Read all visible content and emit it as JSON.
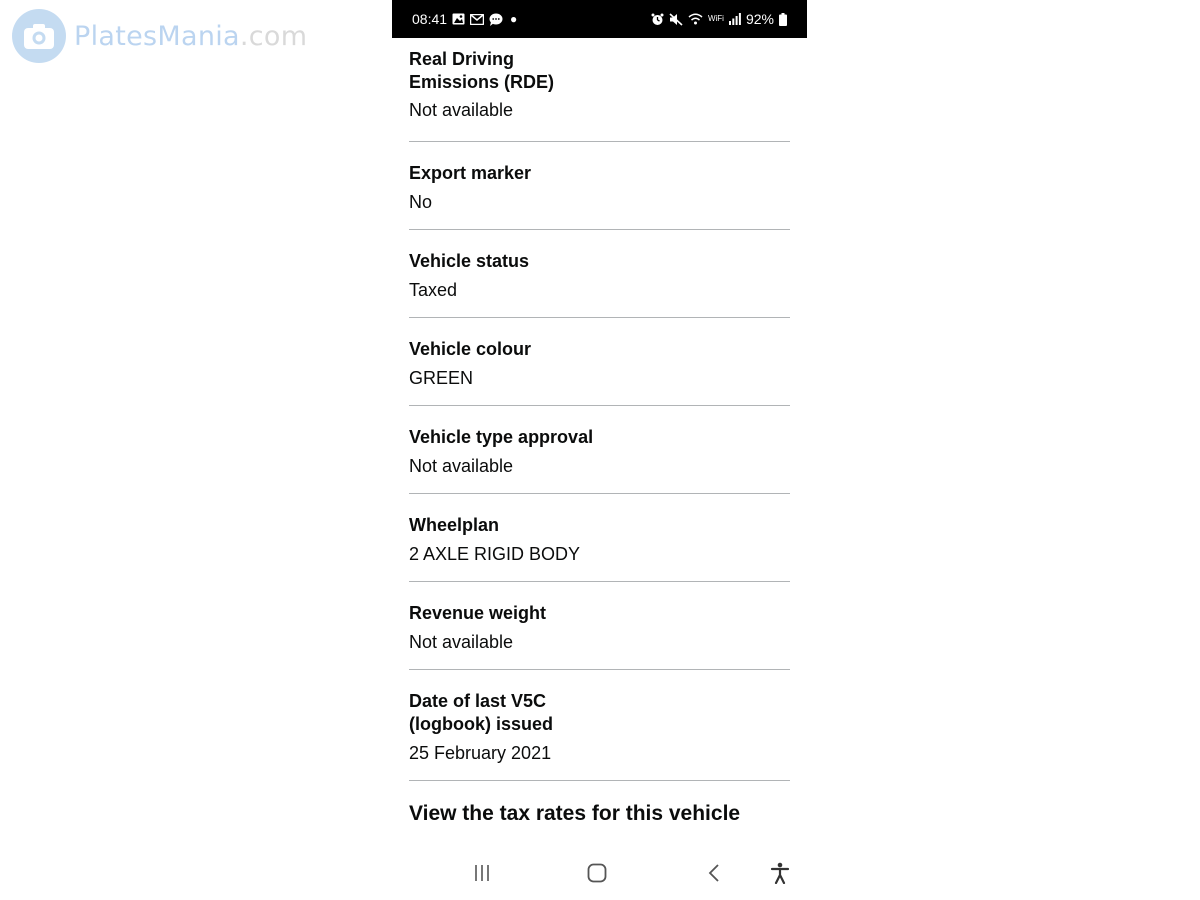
{
  "watermark": {
    "brand_part1": "Plates",
    "brand_part2": "Mania",
    "brand_part3": ".com",
    "icon": "camera-icon"
  },
  "status_bar": {
    "time": "08:41",
    "battery_percent": "92%",
    "wifi_label": "WiFi",
    "left_icons": [
      "gallery-icon",
      "gmail-icon",
      "messages-icon",
      "notification-dot-icon"
    ],
    "right_icons": [
      "alarm-icon",
      "mute-icon",
      "wifi-calling-icon",
      "signal-icon",
      "battery-icon"
    ]
  },
  "details": [
    {
      "label": "Real Driving Emissions (RDE)",
      "value": "Not available"
    },
    {
      "label": "Export marker",
      "value": "No"
    },
    {
      "label": "Vehicle status",
      "value": "Taxed"
    },
    {
      "label": "Vehicle colour",
      "value": "GREEN"
    },
    {
      "label": "Vehicle type approval",
      "value": "Not available"
    },
    {
      "label": "Wheelplan",
      "value": "2 AXLE RIGID BODY"
    },
    {
      "label": "Revenue weight",
      "value": "Not available"
    },
    {
      "label": "Date of last V5C (logbook) issued",
      "value": "25 February 2021"
    }
  ],
  "tax_link": "View the tax rates for this vehicle",
  "nav_bar": {
    "icons": [
      "recent-apps-icon",
      "home-icon",
      "back-icon",
      "accessibility-icon"
    ]
  },
  "colors": {
    "text": "#0b0c0c",
    "divider": "#b1b4b6",
    "status_bar_bg": "#000000",
    "nav_icons": "#555555"
  }
}
